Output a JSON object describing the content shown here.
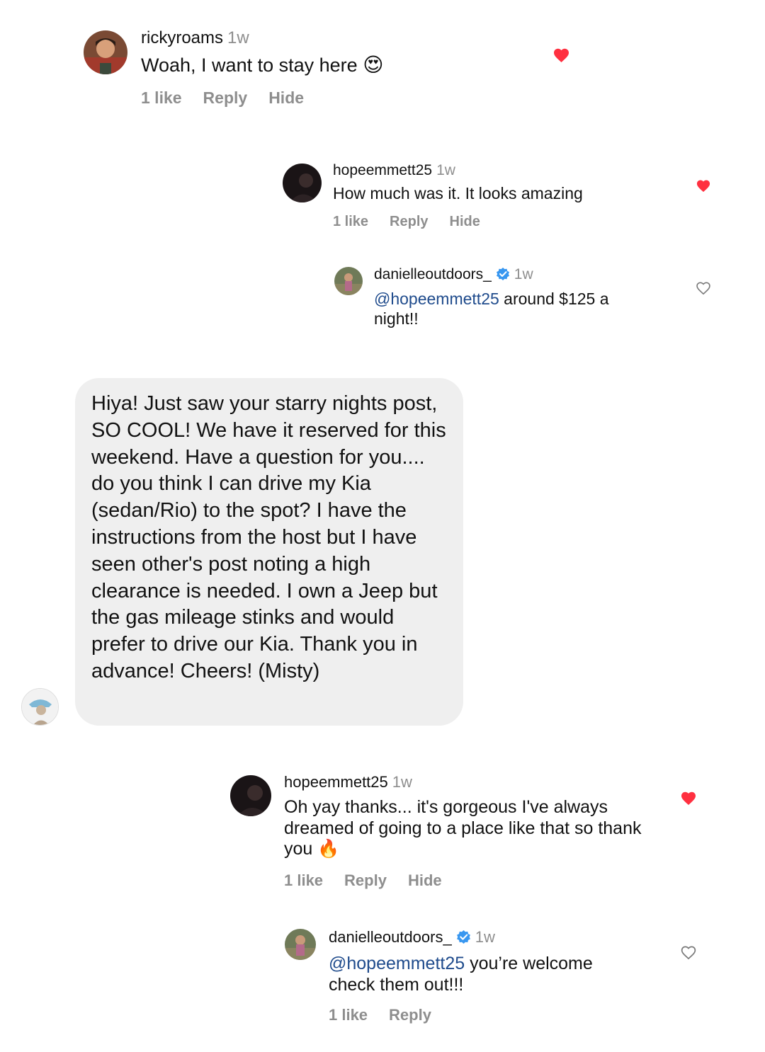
{
  "comments": [
    {
      "username": "rickyroams",
      "time": "1w",
      "text": "Woah, I want to stay here",
      "emoji": "😍",
      "likes": "1 like",
      "reply": "Reply",
      "hide": "Hide",
      "liked": true
    },
    {
      "username": "hopeemmett25",
      "time": "1w",
      "text": "How much was it. It looks amazing",
      "likes": "1 like",
      "reply": "Reply",
      "hide": "Hide",
      "liked": true
    },
    {
      "username": "danielleoutdoors_",
      "time": "1w",
      "verified": true,
      "mention": "@hopeemmett25",
      "text": " around $125 a night!!",
      "liked": false
    },
    {
      "username": "hopeemmett25",
      "time": "1w",
      "text": "Oh yay thanks... it's gorgeous I've always dreamed of going to a place like that so thank you",
      "emoji": "🔥",
      "likes": "1 like",
      "reply": "Reply",
      "hide": "Hide",
      "liked": true
    },
    {
      "username": "danielleoutdoors_",
      "time": "1w",
      "verified": true,
      "mention": "@hopeemmett25",
      "text": " you’re welcome check them out!!!",
      "likes": "1 like",
      "reply": "Reply",
      "liked": false
    }
  ],
  "message": {
    "text": "Hiya! Just saw your starry nights post, SO COOL! We have it reserved for this weekend. Have a question for you.... do you think I can drive my Kia (sedan/Rio) to the spot? I have the instructions from the host but I have seen other's post noting a high clearance is needed. I own a Jeep but the gas mileage stinks and would prefer to drive our Kia. Thank you in advance! Cheers! (Misty)"
  },
  "colors": {
    "like_red": "#ff3040",
    "verified_blue": "#3897f0",
    "muted": "#8e8e8e",
    "bubble_bg": "#efefef"
  }
}
